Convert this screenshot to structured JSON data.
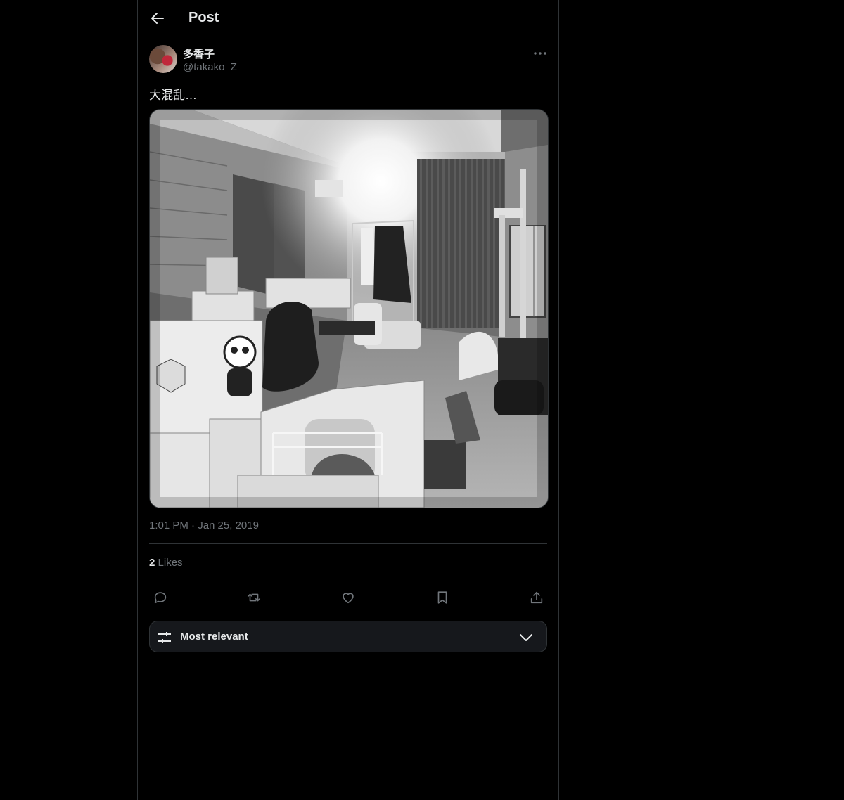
{
  "header": {
    "title": "Post"
  },
  "post": {
    "display_name": "多香子",
    "handle": "@takako_Z",
    "text": "大混乱…",
    "timestamp": "1:01 PM · Jan 25, 2019",
    "likes_count": "2",
    "likes_label": "Likes"
  },
  "actions": {
    "icons": [
      "reply-icon",
      "repost-icon",
      "like-icon",
      "bookmark-icon",
      "share-icon"
    ]
  },
  "sort": {
    "label": "Most relevant"
  },
  "colors": {
    "background": "#000000",
    "text": "#e7e9ea",
    "muted": "#71767b",
    "border": "#2f3336",
    "sort_bg": "#16181c"
  }
}
